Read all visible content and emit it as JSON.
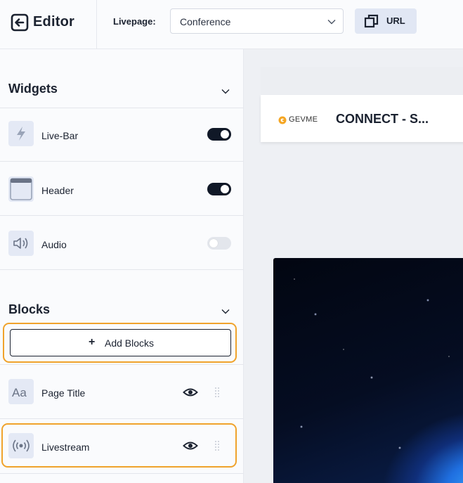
{
  "header": {
    "app_title": "Editor",
    "livepage_label": "Livepage:",
    "livepage_value": "Conference",
    "url_button_label": "URL"
  },
  "sidebar": {
    "widgets": {
      "title": "Widgets",
      "items": [
        {
          "label": "Live-Bar",
          "icon": "lightning-icon",
          "enabled": true
        },
        {
          "label": "Header",
          "icon": "header-layout-icon",
          "enabled": true
        },
        {
          "label": "Audio",
          "icon": "speaker-icon",
          "enabled": false
        }
      ]
    },
    "blocks": {
      "title": "Blocks",
      "add_button_label": "Add Blocks",
      "add_button_icon": "plus-icon",
      "items": [
        {
          "label": "Page Title",
          "icon": "text-aa-icon"
        },
        {
          "label": "Livestream",
          "icon": "broadcast-icon"
        }
      ]
    }
  },
  "preview": {
    "logo_text": "GEVME",
    "page_title": "CONNECT - S..."
  },
  "colors": {
    "highlight": "#f0a32c",
    "toggle_on": "#101827",
    "toggle_off": "#e3e6ec",
    "icon_bg": "#e4e9f5",
    "logo_accent": "#f5a623"
  }
}
